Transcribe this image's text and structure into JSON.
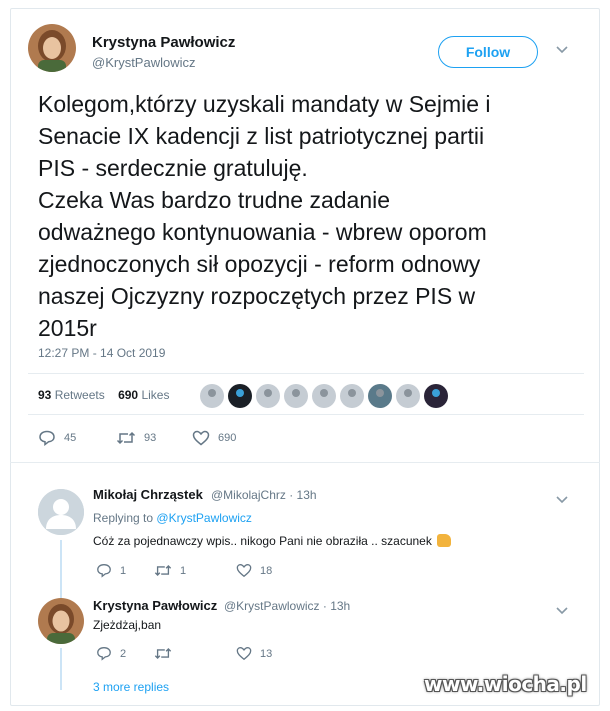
{
  "tweet": {
    "author_name": "Krystyna Pawłowicz",
    "author_handle": "@KrystPawlowicz",
    "follow_label": "Follow",
    "text_lines": [
      "Kolegom,którzy uzyskali mandaty w Sejmie i",
      "Senacie IX kadencji z list patriotycznej partii",
      "PIS - serdecznie gratuluję.",
      "Czeka Was bardzo trudne zadanie",
      "odważnego kontynuowania - wbrew oporom",
      "zjednoczonych sił opozycji - reform odnowy",
      "naszej Ojczyzny rozpoczętych przez PIS w",
      "2015r"
    ],
    "timestamp": "12:27 PM - 14 Oct 2019",
    "retweets_count": "93",
    "retweets_label": "Retweets",
    "likes_count": "690",
    "likes_label": "Likes",
    "reply_count": "45",
    "retweet_action_count": "93",
    "like_action_count": "690"
  },
  "replies": [
    {
      "name": "Mikołaj Chrząstek",
      "handle": "@MikolajChrz",
      "time": "· 13h",
      "replying_to_prefix": "Replying to",
      "replying_to_handle": "@KrystPawlowicz",
      "text": "Cóż za pojednawczy wpis.. nikogo Pani nie obraziła .. szacunek",
      "reply_count": "1",
      "retweet_count": "1",
      "like_count": "18"
    },
    {
      "name": "Krystyna Pawłowicz",
      "handle": "@KrystPawlowicz",
      "time": "· 13h",
      "text": "Zjeżdżaj,ban",
      "reply_count": "2",
      "retweet_count": "",
      "like_count": "13"
    }
  ],
  "more_replies_label": "3 more replies",
  "watermark": "www.wiocha.pl",
  "colors": {
    "accent": "#1da1f2",
    "muted": "#657786",
    "text": "#14171a"
  }
}
